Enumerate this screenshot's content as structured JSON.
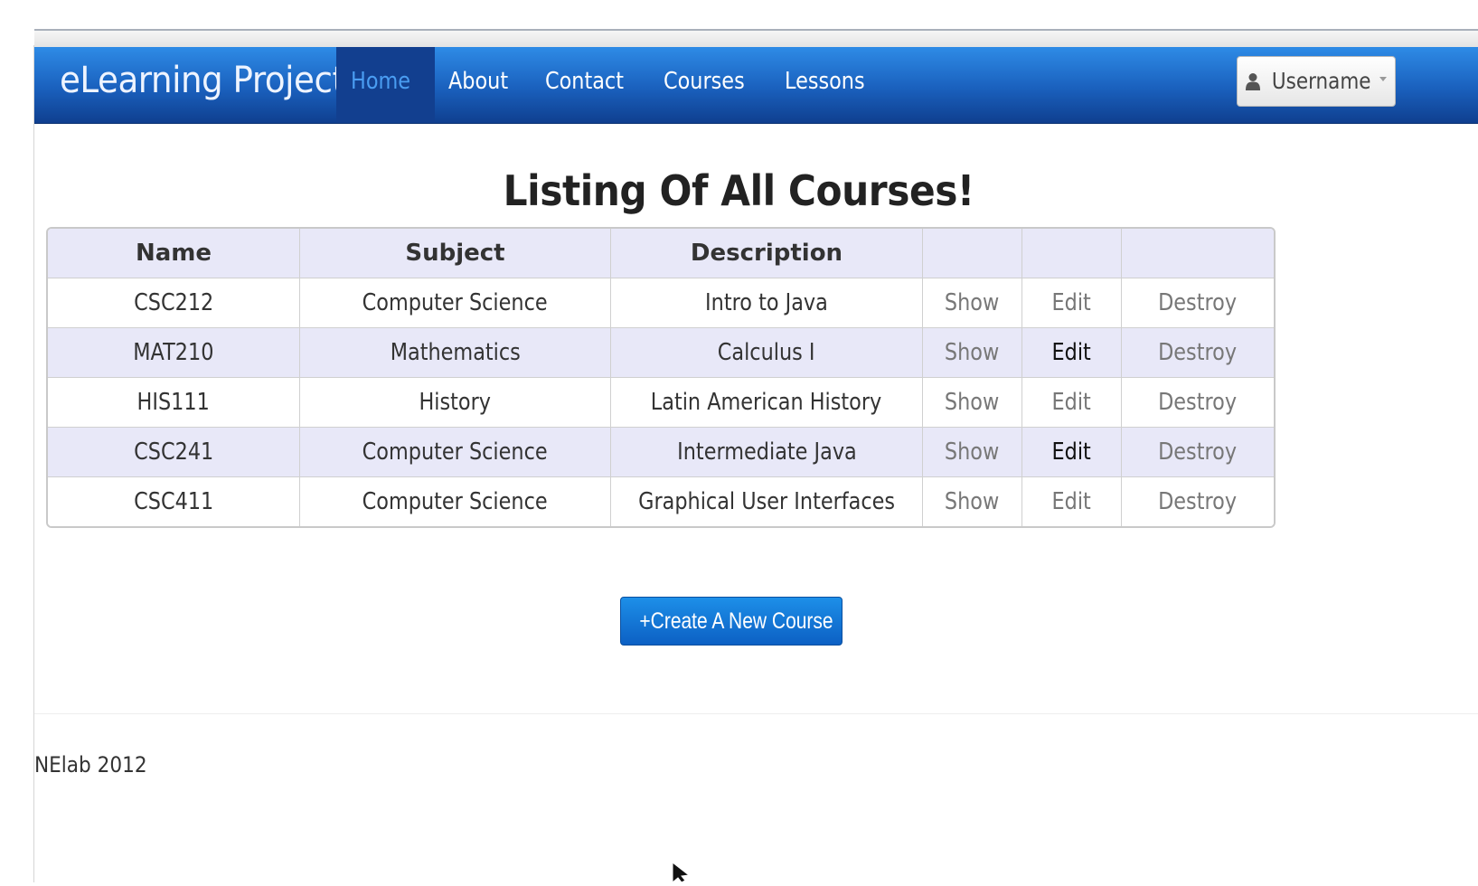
{
  "navbar": {
    "brand": "eLearning Project",
    "items": [
      {
        "label": "Home",
        "active": true
      },
      {
        "label": "About"
      },
      {
        "label": "Contact"
      },
      {
        "label": "Courses"
      },
      {
        "label": "Lessons"
      }
    ],
    "user_button": {
      "label": "Username",
      "icon": "user-icon"
    }
  },
  "page_title": "Listing Of All Courses!",
  "table": {
    "headers": [
      "Name",
      "Subject",
      "Description",
      "",
      "",
      ""
    ],
    "rows": [
      {
        "name": "CSC212",
        "subject": "Computer Science",
        "description": "Intro to Java",
        "show": "Show",
        "edit": "Edit",
        "destroy": "Destroy"
      },
      {
        "name": "MAT210",
        "subject": "Mathematics",
        "description": "Calculus I",
        "show": "Show",
        "edit": "Edit",
        "destroy": "Destroy"
      },
      {
        "name": "HIS111",
        "subject": "History",
        "description": "Latin American History",
        "show": "Show",
        "edit": "Edit",
        "destroy": "Destroy"
      },
      {
        "name": "CSC241",
        "subject": "Computer Science",
        "description": "Intermediate Java",
        "show": "Show",
        "edit": "Edit",
        "destroy": "Destroy"
      },
      {
        "name": "CSC411",
        "subject": "Computer Science",
        "description": "Graphical User Interfaces",
        "show": "Show",
        "edit": "Edit",
        "destroy": "Destroy"
      }
    ]
  },
  "create_button": "+Create A New Course",
  "footer": "NElab 2012",
  "colors": {
    "navbar_top": "#2e8be6",
    "navbar_bottom": "#0f3f8f",
    "active_nav_bg": "#123f8f",
    "active_nav_text": "#4a9df2",
    "row_stripe": "#e8e8f8",
    "button_primary": "#0c60c4"
  }
}
